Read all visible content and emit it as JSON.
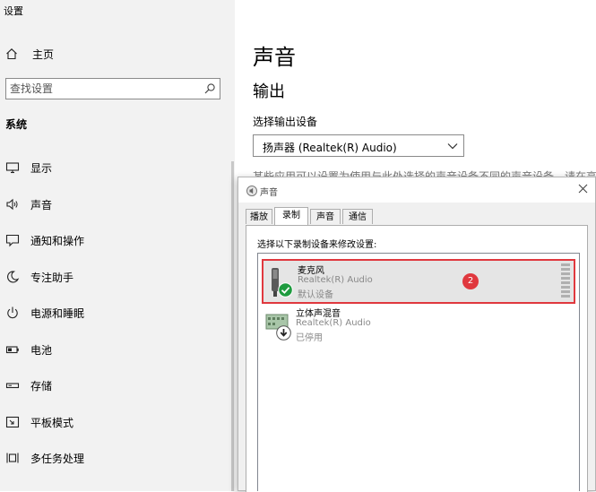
{
  "app": {
    "title": "设置"
  },
  "sidebar": {
    "home_label": "主页",
    "search_placeholder": "查找设置",
    "section_title": "系统",
    "items": [
      {
        "label": "显示",
        "icon": "monitor-icon"
      },
      {
        "label": "声音",
        "icon": "speaker-icon"
      },
      {
        "label": "通知和操作",
        "icon": "notification-icon"
      },
      {
        "label": "专注助手",
        "icon": "moon-icon"
      },
      {
        "label": "电源和睡眠",
        "icon": "power-icon"
      },
      {
        "label": "电池",
        "icon": "battery-icon"
      },
      {
        "label": "存储",
        "icon": "storage-icon"
      },
      {
        "label": "平板模式",
        "icon": "tablet-icon"
      },
      {
        "label": "多任务处理",
        "icon": "multitask-icon"
      }
    ]
  },
  "content": {
    "page_title": "声音",
    "output_title": "输出",
    "output_device_label": "选择输出设备",
    "output_device_value": "扬声器 (Realtek(R) Audio)",
    "description": "某些应用可以设置为使用与此处选择的声音设备不同的声音设备。请在高"
  },
  "dialog": {
    "title": "声音",
    "tabs": [
      "播放",
      "录制",
      "声音",
      "通信"
    ],
    "active_tab": "录制",
    "instruction": "选择以下录制设备来修改设置:",
    "devices": [
      {
        "name": "麦克风",
        "driver": "Realtek(R) Audio",
        "status": "默认设备",
        "icon": "microphone-icon",
        "status_icon": "default-check-icon",
        "selected": true,
        "badge": "2"
      },
      {
        "name": "立体声混音",
        "driver": "Realtek(R) Audio",
        "status": "已停用",
        "icon": "stereo-mix-icon",
        "status_icon": "disabled-arrow-icon",
        "selected": false
      }
    ]
  },
  "colors": {
    "sidebar_bg": "#f2f2f2",
    "dialog_bg": "#f0f0f0",
    "highlight_red": "#e0383e",
    "check_green": "#1e9b3f"
  }
}
